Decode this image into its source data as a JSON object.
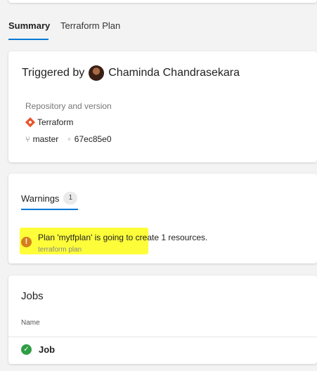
{
  "tabs": [
    {
      "label": "Summary",
      "active": true
    },
    {
      "label": "Terraform Plan",
      "active": false
    }
  ],
  "triggered": {
    "prefix": "Triggered by",
    "user": "Chaminda Chandrasekara",
    "repo_label": "Repository and version",
    "repo_name": "Terraform",
    "branch": "master",
    "commit": "67ec85e0"
  },
  "warnings": {
    "tab_label": "Warnings",
    "count": "1",
    "message": "Plan 'mytfplan' is going to create 1 resources.",
    "source": "terraform plan"
  },
  "jobs": {
    "title": "Jobs",
    "column_name": "Name",
    "items": [
      {
        "name": "Job",
        "status": "success"
      }
    ]
  },
  "colors": {
    "accent": "#0078d4",
    "warning": "#d67e1b",
    "success": "#2f9e44",
    "highlight": "#fdfd3a",
    "git": "#e8552a"
  }
}
